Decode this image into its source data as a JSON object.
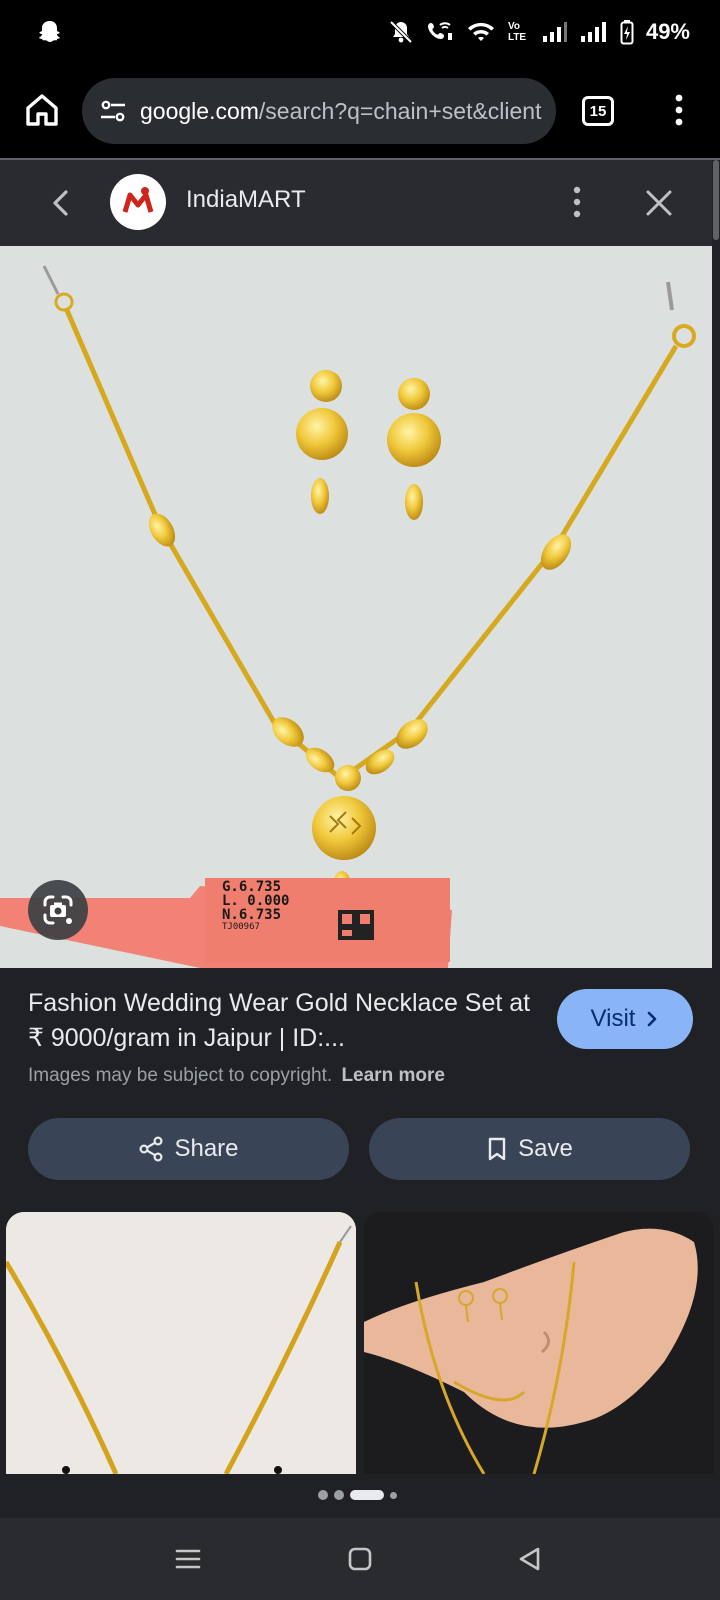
{
  "status_bar": {
    "battery": "49%",
    "volte_label": "Vo LTE"
  },
  "browser": {
    "url_host": "google.com",
    "url_path": "/search?q=chain+set&client",
    "tab_count": "15"
  },
  "sheet": {
    "site_name": "IndiaMART",
    "result_title": "Fashion Wedding Wear Gold Necklace Set at ₹ 9000/gram in Jaipur | ID:...",
    "visit_label": "Visit",
    "copyright_text": "Images may be subject to copyright.",
    "learn_more": "Learn more",
    "share_label": "Share",
    "save_label": "Save"
  },
  "image_tag": {
    "line1": "G.6.735",
    "line2": "L. 0.000",
    "line3": "N.6.735",
    "line4": "TJ00967"
  },
  "carousel": {
    "page_count": 4,
    "active_index": 2
  },
  "colors": {
    "sheet_bg": "#202124",
    "header_bg": "#2a2b30",
    "visit_button": "#8ab4f8",
    "action_button": "#394457",
    "gold": "#e2b62a"
  },
  "icons": {
    "status_left": "snapchat-icon",
    "home": "home-icon",
    "url_settings": "tune-icon",
    "back": "chevron-left-icon",
    "close": "close-icon",
    "more": "more-vert-icon",
    "lens": "google-lens-icon",
    "share": "share-icon",
    "save": "bookmark-icon"
  }
}
